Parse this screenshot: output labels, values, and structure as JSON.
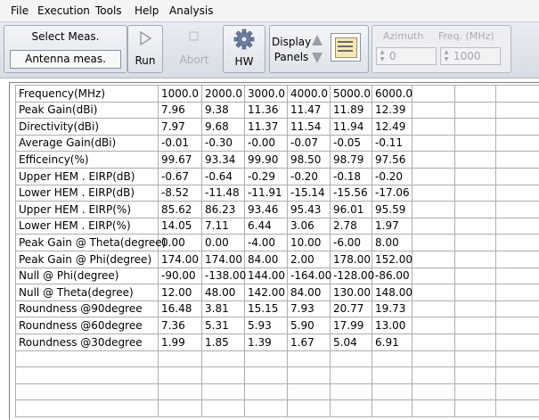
{
  "menu": [
    "File",
    "Execution",
    "Tools",
    "Help",
    "Analysis"
  ],
  "toolbar": {
    "select_meas_label": "Select Meas.",
    "antenna_meas_label": "Antenna meas.",
    "run_label": "Run",
    "abort_label": "Abort",
    "hw_label": "HW",
    "display_label": "Display",
    "panels_label": "Panels",
    "azimuth_label": "Azimuth",
    "azimuth_value": "0",
    "freq_label": "Freq. (MHz)",
    "freq_value": "1000"
  },
  "table": {
    "rows": [
      [
        "Frequency(MHz)",
        "1000.0",
        "2000.0",
        "3000.0",
        "4000.0",
        "5000.0",
        "6000.0"
      ],
      [
        "Peak Gain(dBi)",
        "7.96",
        "9.38",
        "11.36",
        "11.47",
        "11.89",
        "12.39"
      ],
      [
        "Directivity(dBi)",
        "7.97",
        "9.68",
        "11.37",
        "11.54",
        "11.94",
        "12.49"
      ],
      [
        "Average Gain(dBi)",
        "-0.01",
        "-0.30",
        "-0.00",
        "-0.07",
        "-0.05",
        "-0.11"
      ],
      [
        "Efficeincy(%)",
        "99.67",
        "93.34",
        "99.90",
        "98.50",
        "98.79",
        "97.56"
      ],
      [
        "Upper HEM . EIRP(dB)",
        "-0.67",
        "-0.64",
        "-0.29",
        "-0.20",
        "-0.18",
        "-0.20"
      ],
      [
        "Lower HEM . EIRP(dB)",
        "-8.52",
        "-11.48",
        "-11.91",
        "-15.14",
        "-15.56",
        "-17.06"
      ],
      [
        "Upper HEM . EIRP(%)",
        "85.62",
        "86.23",
        "93.46",
        "95.43",
        "96.01",
        "95.59"
      ],
      [
        "Lower HEM . EIRP(%)",
        "14.05",
        "7.11",
        "6.44",
        "3.06",
        "2.78",
        "1.97"
      ],
      [
        "Peak Gain @ Theta(degree)",
        "0.00",
        "0.00",
        "-4.00",
        "10.00",
        "-6.00",
        "8.00"
      ],
      [
        "Peak Gain @ Phi(degree)",
        "174.00",
        "174.00",
        "84.00",
        "2.00",
        "178.00",
        "152.00"
      ],
      [
        "Null @ Phi(degree)",
        "-90.00",
        "-138.00",
        "144.00",
        "-164.00",
        "-128.00",
        "-86.00"
      ],
      [
        "Null @ Theta(degree)",
        "12.00",
        "48.00",
        "142.00",
        "84.00",
        "130.00",
        "148.00"
      ],
      [
        "Roundness @90degree",
        "16.48",
        "3.81",
        "15.15",
        "7.93",
        "20.77",
        "19.73"
      ],
      [
        "Roundness @60degree",
        "7.36",
        "5.31",
        "5.93",
        "5.90",
        "17.99",
        "13.00"
      ],
      [
        "Roundness @30degree",
        "1.99",
        "1.85",
        "1.39",
        "1.67",
        "5.04",
        "6.91"
      ]
    ]
  }
}
